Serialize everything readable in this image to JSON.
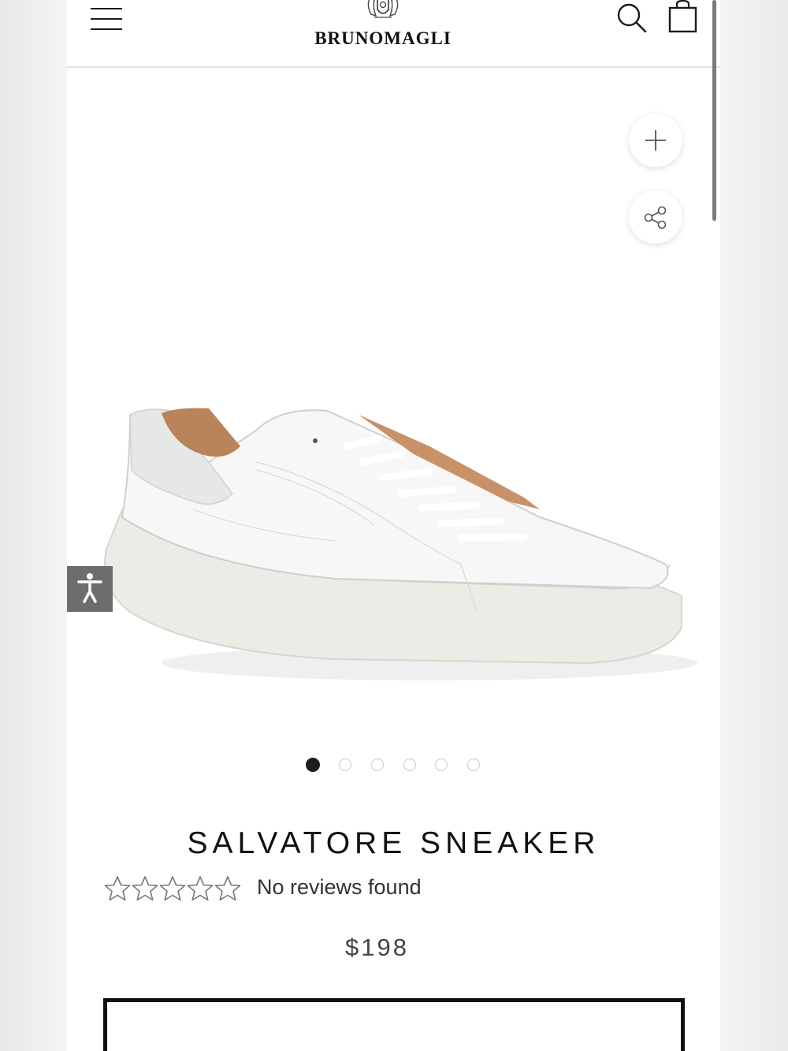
{
  "header": {
    "menu_icon": "hamburger-menu-icon",
    "brand": "BRUNOMAGLI",
    "search_icon": "search-icon",
    "bag_icon": "shopping-bag-icon"
  },
  "gallery": {
    "zoom_icon": "plus-icon",
    "share_icon": "share-icon",
    "accessibility_icon": "accessibility-icon",
    "slide_count": 6,
    "active_slide": 1
  },
  "product": {
    "title": "SALVATORE SNEAKER",
    "rating_stars": 0,
    "rating_max": 5,
    "reviews_text": "No reviews found",
    "price": "$198"
  },
  "colors": {
    "accent": "#111111",
    "accessibility_button": "#6d6d6d"
  }
}
